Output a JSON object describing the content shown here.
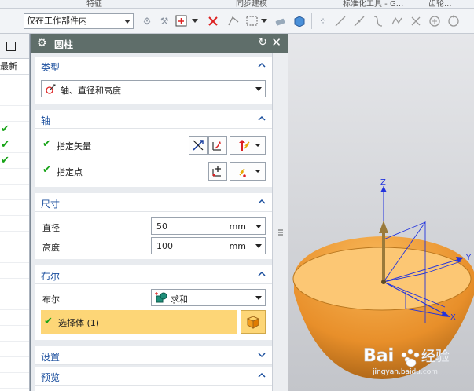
{
  "top_strip": {
    "items": [
      "特征",
      "同步建模",
      "标准化工具 - G...",
      "齿轮..."
    ]
  },
  "toolbar": {
    "selection_filter": "仅在工作部件内"
  },
  "navigator": {
    "column_header": "最新",
    "check_rows": [
      true,
      true,
      true
    ]
  },
  "dialog": {
    "title": "圆柱",
    "sections": {
      "type": {
        "header": "类型",
        "value": "轴、直径和高度"
      },
      "axis": {
        "header": "轴",
        "vector_label": "指定矢量",
        "point_label": "指定点"
      },
      "dimensions": {
        "header": "尺寸",
        "diameter_label": "直径",
        "diameter_value": "50",
        "diameter_unit": "mm",
        "height_label": "高度",
        "height_value": "100",
        "height_unit": "mm"
      },
      "boolean": {
        "header": "布尔",
        "boolean_label": "布尔",
        "boolean_value": "求和",
        "select_body_label": "选择体 (1)"
      },
      "settings": {
        "header": "设置"
      },
      "preview": {
        "header": "预览"
      }
    }
  },
  "viewport": {
    "axis_labels": {
      "z": "Z",
      "y": "Y",
      "x": "X"
    },
    "colors": {
      "shape_fill": "#f0a84a",
      "shape_top": "#fcc774",
      "axis_arrow": "#9a7a3a",
      "wcs_lines": "#2233dd"
    }
  },
  "watermark": {
    "brand": "Bai",
    "brand_suffix": "经验",
    "url": "jingyan.baidu.com"
  }
}
